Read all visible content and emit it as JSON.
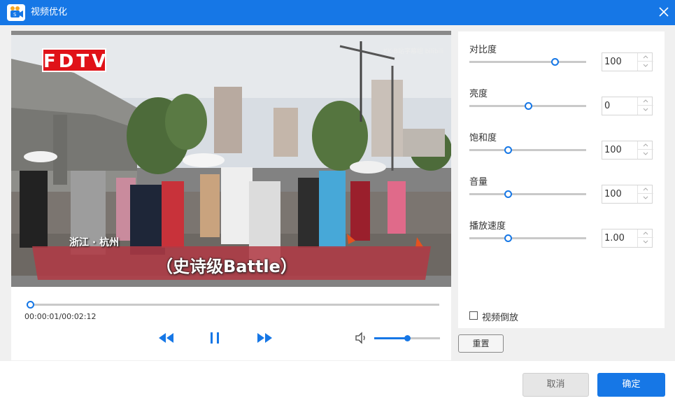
{
  "window": {
    "title": "视频优化",
    "app_icon": "camera-app-icon",
    "close_icon": "close-icon",
    "accent_color": "#1677e6"
  },
  "video": {
    "logo_text": "FDTV",
    "watermark": "KK·B站字幕组 bilibili",
    "location_caption": "浙江 · 杭州",
    "subtitle": "（史诗级Battle）"
  },
  "player": {
    "time_display": "00:00:01/00:02:12",
    "progress_fraction": 0.008,
    "volume_fraction": 0.5,
    "controls": {
      "rewind_icon": "rewind-icon",
      "pause_icon": "pause-icon",
      "forward_icon": "fast-forward-icon",
      "volume_icon": "speaker-icon"
    }
  },
  "settings": [
    {
      "label": "对比度",
      "value": "100",
      "slider_fraction": 0.73
    },
    {
      "label": "亮度",
      "value": "0",
      "slider_fraction": 0.5
    },
    {
      "label": "饱和度",
      "value": "100",
      "slider_fraction": 0.33
    },
    {
      "label": "音量",
      "value": "100",
      "slider_fraction": 0.33
    },
    {
      "label": "播放速度",
      "value": "1.00",
      "slider_fraction": 0.33
    }
  ],
  "reverse": {
    "label": "视频倒放",
    "checked": false
  },
  "buttons": {
    "reset": "重置",
    "cancel": "取消",
    "ok": "确定"
  }
}
